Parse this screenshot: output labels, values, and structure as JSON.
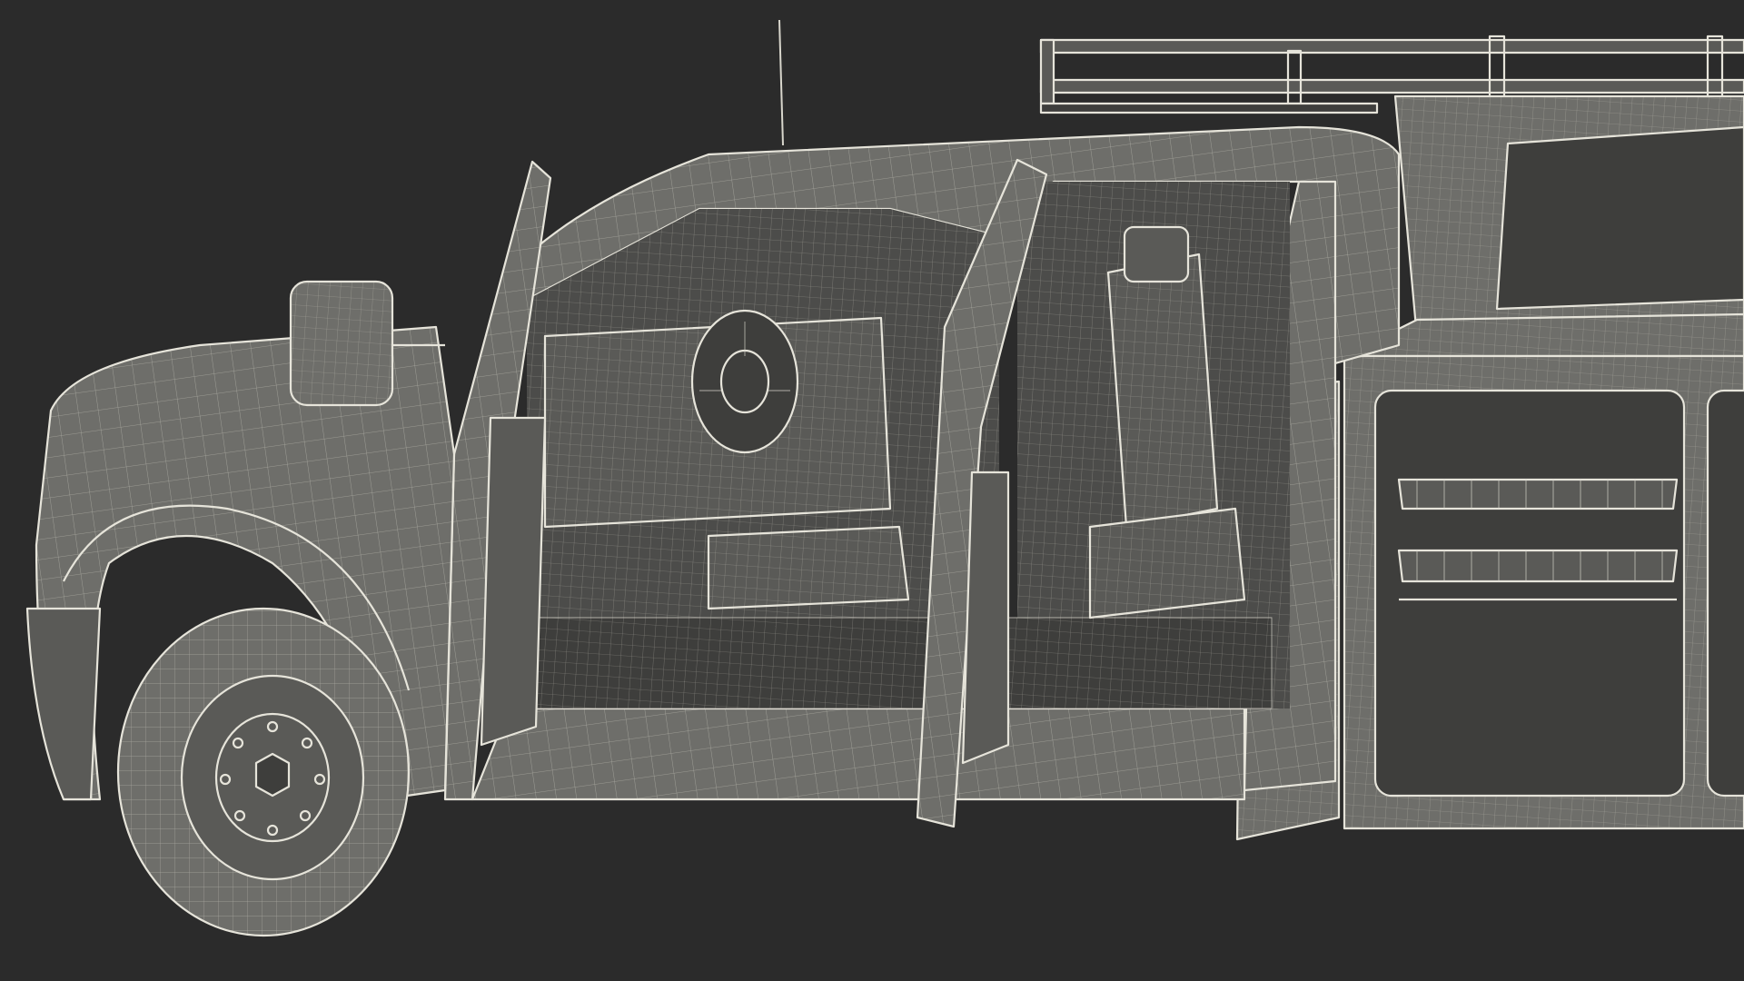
{
  "scene": {
    "subject": "wireframe-render-utility-service-truck",
    "background_color": "#2b2b2b",
    "surface_color": "#6e6e6a",
    "wire_color": "#e6e4da",
    "icons": [
      "wheel-icon",
      "mirror-icon",
      "door-icon",
      "seat-icon",
      "steering-wheel-icon",
      "ladder-rack-icon",
      "tool-compartment-icon"
    ]
  }
}
